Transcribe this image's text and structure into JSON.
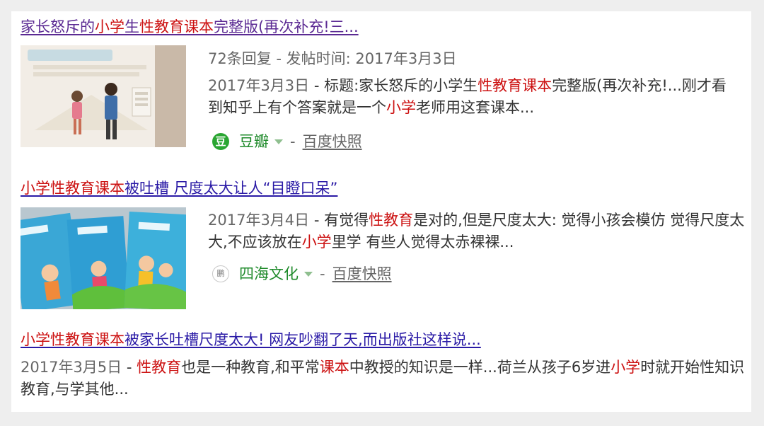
{
  "results": [
    {
      "title_parts": [
        "家长怒斥的",
        "小学",
        "生",
        "性教育课本",
        "完整版(再次补充!三..."
      ],
      "meta": "72条回复 - 发帖时间: 2017年3月3日",
      "date": "2017年3月3日",
      "abstract_parts": [
        " - 标题:家长怒斥的小学生",
        "性教育课本",
        "完整版(再次补充!...刚才看到知乎上有个答案就是一个",
        "小学",
        "老师用这套课本..."
      ],
      "source": {
        "icon": "豆",
        "icon_name": "douban-icon",
        "name": "豆瓣",
        "snapshot": "百度快照"
      }
    },
    {
      "title_parts": [
        "小学性教育课本",
        "被吐槽 尺度太大让人“目瞪口呆”"
      ],
      "date": "2017年3月4日",
      "abstract_parts": [
        " - 有觉得",
        "性教育",
        "是对的,但是尺度太大: 觉得小孩会模仿 觉得尺度太大,不应该放在",
        "小学",
        "里学 有些人觉得太赤裸裸..."
      ],
      "source": {
        "icon": "鹏",
        "icon_name": "sihai-icon",
        "name": "四海文化",
        "snapshot": "百度快照"
      }
    },
    {
      "title_parts": [
        "小学性教育课本",
        "被家长吐槽尺度太大! 网友吵翻了天,而出版社这样说..."
      ],
      "date": "2017年3月5日",
      "abstract_parts": [
        " - ",
        "性教育",
        "也是一种教育,和平常",
        "课本",
        "中教授的知识是一样...荷兰从孩子6岁进",
        "小学",
        "时就开始性知识教育,与学其他..."
      ]
    }
  ],
  "colors": {
    "link": "#2a1aa6",
    "visited": "#5b2a93",
    "highlight": "#cc1111",
    "source": "#1e8a2a"
  }
}
